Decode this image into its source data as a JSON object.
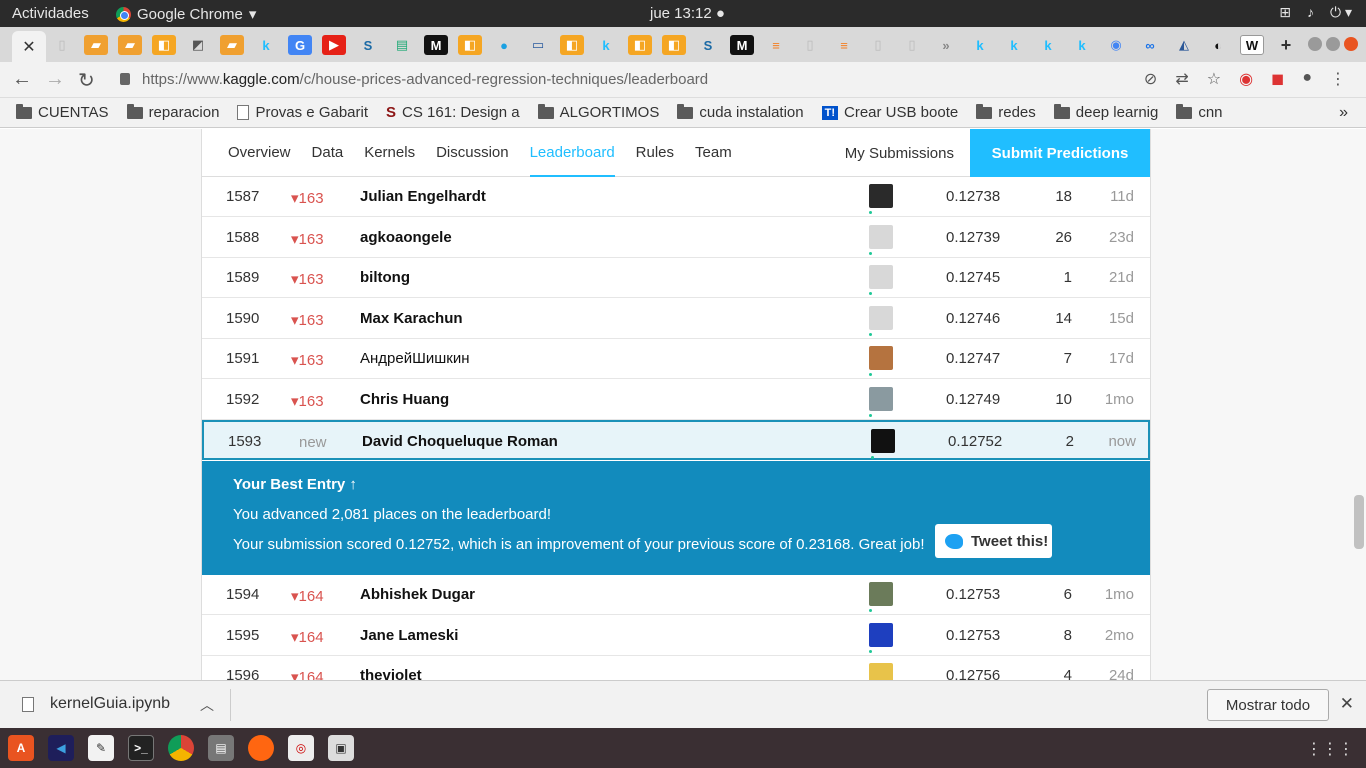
{
  "topbar": {
    "activities": "Actividades",
    "app_name": "Google Chrome",
    "clock": "jue 13:12 ●"
  },
  "tabs": {
    "active_close": "✕",
    "new_tab": "+"
  },
  "addressbar": {
    "url_prefix": "https://www.",
    "url_domain": "kaggle.com",
    "url_path": "/c/house-prices-advanced-regression-techniques/leaderboard"
  },
  "bookmarks": [
    {
      "label": "CUENTAS",
      "type": "folder"
    },
    {
      "label": "reparacion",
      "type": "folder"
    },
    {
      "label": "Provas e Gabarit",
      "type": "page"
    },
    {
      "label": "CS 161: Design a",
      "type": "page"
    },
    {
      "label": "ALGORTIMOS",
      "type": "folder"
    },
    {
      "label": "cuda instalation",
      "type": "folder"
    },
    {
      "label": "Crear USB boote",
      "type": "page"
    },
    {
      "label": "redes",
      "type": "folder"
    },
    {
      "label": "deep learnig",
      "type": "folder"
    },
    {
      "label": "cnn",
      "type": "folder"
    }
  ],
  "nav": {
    "tabs": [
      "Overview",
      "Data",
      "Kernels",
      "Discussion",
      "Leaderboard",
      "Rules",
      "Team"
    ],
    "active": "Leaderboard",
    "my_submissions": "My Submissions",
    "submit": "Submit Predictions"
  },
  "leaderboard": {
    "rows_before": [
      {
        "rank": "1587",
        "delta": "163",
        "name": "Julian Engelhardt",
        "bold": true,
        "score": "0.12738",
        "entries": "18",
        "last": "11d",
        "avatar_color": "#2a2a2a"
      },
      {
        "rank": "1588",
        "delta": "163",
        "name": "agkoaongele",
        "bold": true,
        "score": "0.12739",
        "entries": "26",
        "last": "23d",
        "avatar_color": "#d8d8d8"
      },
      {
        "rank": "1589",
        "delta": "163",
        "name": "biltong",
        "bold": true,
        "score": "0.12745",
        "entries": "1",
        "last": "21d",
        "avatar_color": "#d8d8d8"
      },
      {
        "rank": "1590",
        "delta": "163",
        "name": "Max Karachun",
        "bold": true,
        "score": "0.12746",
        "entries": "14",
        "last": "15d",
        "avatar_color": "#d8d8d8"
      },
      {
        "rank": "1591",
        "delta": "163",
        "name": "АндрейШишкин",
        "bold": false,
        "score": "0.12747",
        "entries": "7",
        "last": "17d",
        "avatar_color": "#b5733f"
      },
      {
        "rank": "1592",
        "delta": "163",
        "name": "Chris Huang",
        "bold": true,
        "score": "0.12749",
        "entries": "10",
        "last": "1mo",
        "avatar_color": "#8a9aa0"
      }
    ],
    "me": {
      "rank": "1593",
      "delta": "new",
      "name": "David Choqueluque Roman",
      "score": "0.12752",
      "entries": "2",
      "last": "now",
      "avatar_color": "#111111"
    },
    "rows_after": [
      {
        "rank": "1594",
        "delta": "164",
        "name": "Abhishek Dugar",
        "bold": true,
        "score": "0.12753",
        "entries": "6",
        "last": "1mo",
        "avatar_color": "#6b7b5a"
      },
      {
        "rank": "1595",
        "delta": "164",
        "name": "Jane Lameski",
        "bold": true,
        "score": "0.12753",
        "entries": "8",
        "last": "2mo",
        "avatar_color": "#1e3fbf"
      },
      {
        "rank": "1596",
        "delta": "164",
        "name": "theviolet",
        "bold": true,
        "score": "0.12756",
        "entries": "4",
        "last": "24d",
        "avatar_color": "#e8c34a"
      }
    ]
  },
  "best_entry": {
    "title": "Your Best Entry ↑",
    "line1": "You advanced 2,081 places on the leaderboard!",
    "line2": "Your submission scored 0.12752, which is an improvement of your previous score of 0.23168. Great job!",
    "tweet": "Tweet this!"
  },
  "downloads": {
    "file": "kernelGuia.ipynb",
    "show_all": "Mostrar todo"
  },
  "colors": {
    "kaggle_blue": "#20beff",
    "best_entry_bg": "#128bbd",
    "delta_red": "#d9534f"
  }
}
